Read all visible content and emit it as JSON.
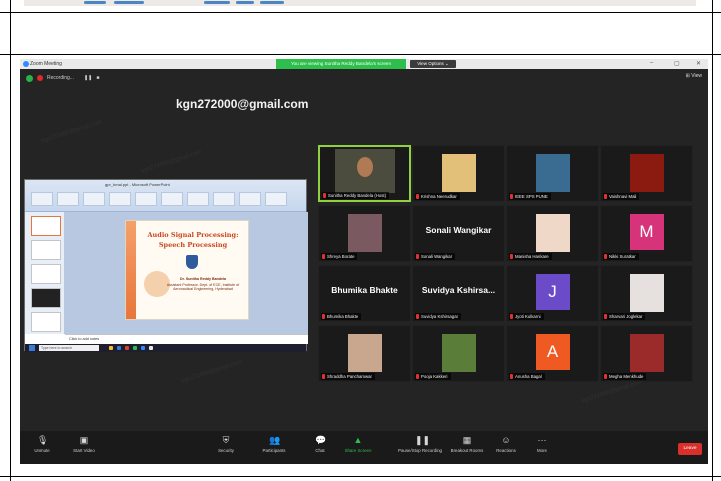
{
  "window": {
    "title": "Zoom Meeting",
    "banner": "You are viewing Sunitha Reddy Bandela's screen",
    "view_options": "View Options ⌄",
    "view_button": "⊞ View",
    "minimize": "–",
    "maximize": "▢",
    "close": "✕"
  },
  "recording": {
    "label": "Recording...",
    "pause": "❚❚",
    "stop": "■"
  },
  "watermark_email": "kgn272000@gmail.com",
  "shared_screen": {
    "app_title": "gpr_hmal.ppt - Microsoft PowerPoint",
    "slide_title_1": "Audio Signal Processing:",
    "slide_title_2": "Speech Processing",
    "slide_author": "Dr. Sunitha Reddy Bandela",
    "slide_affiliation": "Assistant Professor, Dept. of ECE, Institute of Aeronautical Engineering, Hyderabad",
    "notes": "Click to add notes",
    "search_placeholder": "Type here to search"
  },
  "participants": [
    {
      "name": "Sunitha Reddy Bandela (Host)",
      "kind": "video",
      "active": true,
      "color": "#4b4b3e"
    },
    {
      "name": "Krishna Neerudkar",
      "kind": "photo",
      "color": "#e3c07a"
    },
    {
      "name": "IEEE SPS PUNE",
      "kind": "photo",
      "color": "#3a6b91"
    },
    {
      "name": "Vaishnavi Mali",
      "kind": "photo",
      "color": "#8b1a10"
    },
    {
      "name": "Shreya Borate",
      "kind": "photo",
      "color": "#7a5a60"
    },
    {
      "name": "Sonali Wangikar",
      "kind": "text",
      "display": "Sonali Wangikar"
    },
    {
      "name": "Manisha Hankare",
      "kind": "photo",
      "color": "#f0d8c8"
    },
    {
      "name": "Nikki Suratkar",
      "kind": "avatar",
      "letter": "M",
      "color": "#d6337a"
    },
    {
      "name": "Bhumika Bhakte",
      "kind": "text",
      "display": "Bhumika Bhakte"
    },
    {
      "name": "Suvidya Kshirsagar",
      "kind": "text",
      "display": "Suvidya Kshirsa..."
    },
    {
      "name": "Jyoti Kulkarni",
      "kind": "avatar",
      "letter": "J",
      "color": "#6b4bc8"
    },
    {
      "name": "Sharvari Joglekar",
      "kind": "photo",
      "color": "#e6e1df"
    },
    {
      "name": "Shraddha Panchamwar",
      "kind": "photo",
      "color": "#c9a78e"
    },
    {
      "name": "Pooja Kakkeri",
      "kind": "photo",
      "color": "#5a7d3a"
    },
    {
      "name": "Anusha Bagal",
      "kind": "avatar",
      "letter": "A",
      "color": "#ef5a22"
    },
    {
      "name": "Megha Menkhude",
      "kind": "photo",
      "color": "#9b2a2a"
    }
  ],
  "toolbar": {
    "unmute": "Unmute",
    "start_video": "Start Video",
    "security": "Security",
    "participants": "Participants",
    "participants_count": "16",
    "chat": "Chat",
    "share_screen": "Share Screen",
    "pause_recording": "Pause/Stop Recording",
    "breakout_rooms": "Breakout Rooms",
    "reactions": "Reactions",
    "more": "More",
    "leave": "Leave"
  },
  "icons": {
    "mic": "mic-muted-icon",
    "video": "video-off-icon",
    "security": "shield-icon",
    "participants": "people-icon",
    "chat": "chat-bubble-icon",
    "share": "share-screen-icon",
    "record": "record-icon",
    "breakout": "grid-icon",
    "reactions": "emoji-icon",
    "more": "ellipsis-icon"
  },
  "colors": {
    "zoom_bg": "#242424",
    "active_speaker": "#8fd13f",
    "share_green": "#2dbe4c",
    "leave_red": "#d9302c"
  }
}
